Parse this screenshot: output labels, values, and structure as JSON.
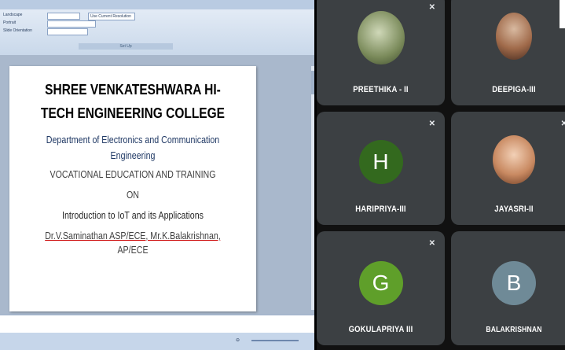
{
  "presentation": {
    "ribbon": {
      "rows": [
        "Landscape",
        "Portrait",
        "Slide Orientation"
      ],
      "check_label": "Use Current Resolution",
      "group_label": "Set Up"
    },
    "slide": {
      "title_line1": "SHREE VENKATESHWARA HI-",
      "title_line2": "TECH ENGINEERING COLLEGE",
      "dept_line1": "Department of Electronics and Communication",
      "dept_line2": "Engineering",
      "program_line": "VOCATIONAL EDUCATION AND TRAINING",
      "on_line": "ON",
      "topic_line": "Introduction to IoT and its Applications",
      "presenters_line1": "Dr.V.Saminathan ASP/ECE, Mr.K.Balakrishnan,",
      "presenters_line2": "AP/ECE"
    }
  },
  "participants": [
    {
      "name": "PREETHIKA - II",
      "avatar": "photo",
      "muted": true
    },
    {
      "name": "DEEPIGA-III",
      "avatar": "photo",
      "muted": true
    },
    {
      "name": "HARIPRIYA-III",
      "avatar": "letter",
      "initial": "H",
      "color": "#33691e",
      "muted": true
    },
    {
      "name": "JAYASRI-II",
      "avatar": "photo",
      "muted": true
    },
    {
      "name": "GOKULAPRIYA III",
      "avatar": "letter",
      "initial": "G",
      "color": "#5f9f2a",
      "muted": true
    },
    {
      "name": "BALAKRISHNAN",
      "avatar": "letter",
      "initial": "B",
      "color": "#6f8a97",
      "muted": false
    }
  ],
  "icons": {
    "mic_off": "mic-off-icon"
  },
  "colors": {
    "tile_bg": "#3c4043",
    "grid_bg": "#111111"
  }
}
